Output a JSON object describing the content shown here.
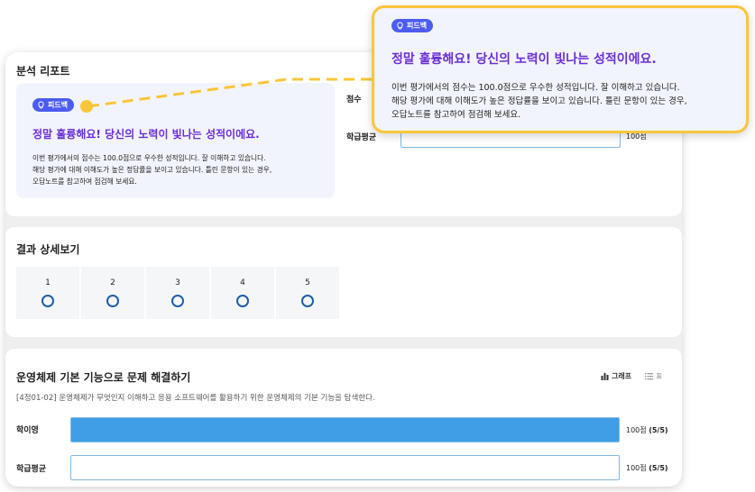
{
  "report": {
    "title": "분석 리포트",
    "feedback": {
      "badge": "피드백",
      "heading": "정말 훌륭해요! 당신의 노력이 빛나는 성적이에요.",
      "body": "이번 평가에서의 점수는 100.0점으로 우수한 성적입니다. 잘 이해하고 있습니다.\n해당 평가에 대해 이해도가 높은 정답률을 보이고 있습니다. 틀린 문항이 있는 경우,\n오답노트를 참고하여 점검해 보세요."
    },
    "score_label": "점수",
    "class_avg_label": "학급평균",
    "class_avg_value": "100점"
  },
  "results": {
    "title": "결과 상세보기",
    "questions": [
      {
        "number": "1",
        "result": "correct"
      },
      {
        "number": "2",
        "result": "correct"
      },
      {
        "number": "3",
        "result": "correct"
      },
      {
        "number": "4",
        "result": "correct"
      },
      {
        "number": "5",
        "result": "correct"
      }
    ]
  },
  "skill": {
    "title": "운영체제 기본 기능으로 문제 해결하기",
    "standard": "[4정01-02] 운영체제가 무엇인지 이해하고 응용 소프트웨어를 활용하기 위한 운영체제의 기본 기능을 탐색한다.",
    "view_graph": "그래프",
    "view_table": "표",
    "rows": [
      {
        "label": "학이영",
        "score": "100점",
        "count": "(5/5)",
        "fraction": 1.0
      },
      {
        "label": "학급평균",
        "score": "100점",
        "count": "(5/5)",
        "fraction": 0.0
      }
    ]
  },
  "popup": {
    "badge": "피드백",
    "heading": "정말 훌륭해요! 당신의 노력이 빛나는 성적이에요.",
    "body": "이번 평가에서의 점수는 100.0점으로 우수한 성적입니다. 잘 이해하고 있습니다.\n해당 평가에 대해 이해도가 높은 정답률을 보이고 있습니다. 틀린 문항이 있는 경우,\n오답노트를 참고하여 점검해 보세요."
  },
  "colors": {
    "accent_blue": "#3f9ee6",
    "badge_blue": "#4b5cf0",
    "heading_purple": "#6a2fd6",
    "highlight_yellow": "#f8c63a",
    "correct_mark": "#1f5fa8"
  }
}
